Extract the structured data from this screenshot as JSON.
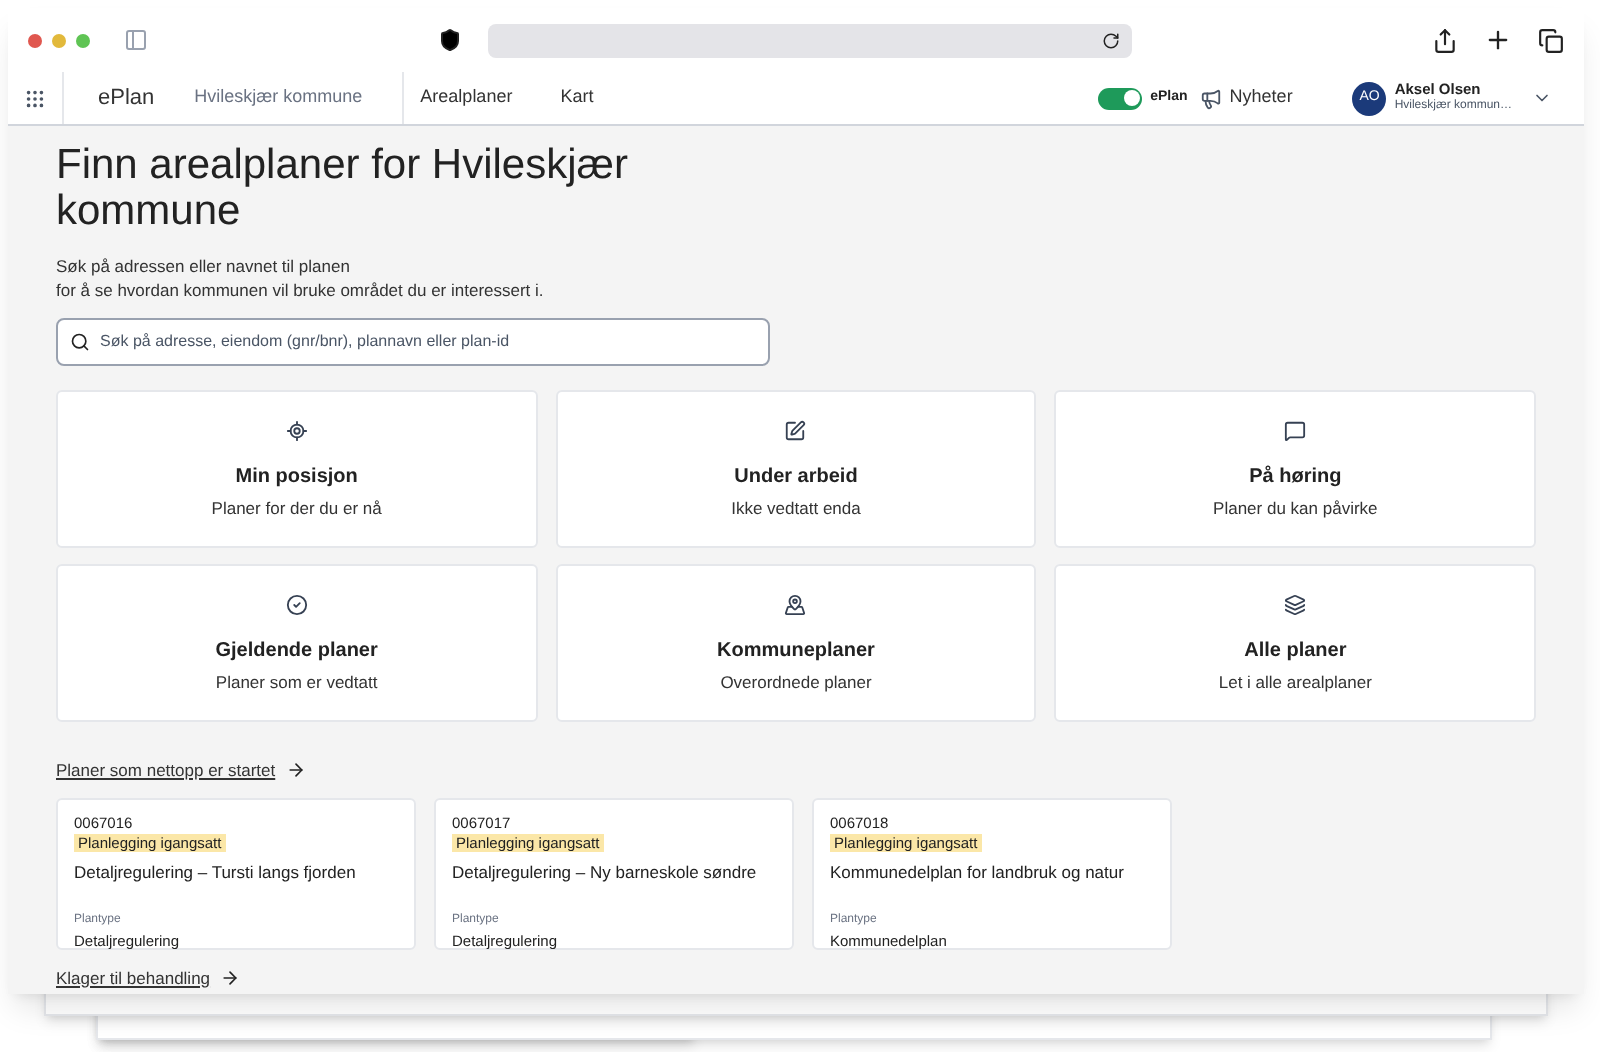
{
  "app_bar": {
    "brand": "ePlan",
    "municipality": "Hvileskjær kommune",
    "nav": [
      {
        "label": "Arealplaner",
        "selected": false
      },
      {
        "label": "Kart",
        "selected": false
      }
    ],
    "toggle": {
      "label": "ePlan",
      "on": true
    },
    "news": "Nyheter",
    "user": {
      "initials": "AO",
      "name": "Aksel Olsen",
      "org": "Hvileskjær kommun…"
    }
  },
  "heading": "Finn arealplaner for Hvileskjær kommune",
  "intro": [
    "Søk på adressen eller navnet til planen",
    "for å se hvordan kommunen vil bruke området du er interessert i."
  ],
  "search": {
    "placeholder": "Søk på adresse, eiendom (gnr/bnr), plannavn eller plan-id"
  },
  "categories": [
    {
      "kind": "position",
      "title": "Min posisjon",
      "subtitle": "Planer for der du er nå"
    },
    {
      "kind": "work",
      "title": "Under arbeid",
      "subtitle": "Ikke vedtatt enda"
    },
    {
      "kind": "hearing",
      "title": "På høring",
      "subtitle": "Planer du kan påvirke"
    },
    {
      "kind": "valid",
      "title": "Gjeldende planer",
      "subtitle": "Planer som er vedtatt"
    },
    {
      "kind": "municipal",
      "title": "Kommuneplaner",
      "subtitle": "Overordnede planer"
    },
    {
      "kind": "all",
      "title": "Alle planer",
      "subtitle": "Let i alle arealplaner"
    }
  ],
  "recent": {
    "title": "Planer som nettopp er startet",
    "plans": [
      {
        "id": "0067016",
        "status": "Planlegging igangsatt",
        "name": "Detaljregulering – Tursti langs fjorden",
        "type_label": "Plantype",
        "type": "Detaljregulering"
      },
      {
        "id": "0067017",
        "status": "Planlegging igangsatt",
        "name": "Detaljregulering – Ny barneskole søndre",
        "type_label": "Plantype",
        "type": "Detaljregulering"
      },
      {
        "id": "0067018",
        "status": "Planlegging igangsatt",
        "name": "Kommunedelplan for landbruk og natur",
        "type_label": "Plantype",
        "type": "Kommunedelplan"
      }
    ]
  },
  "complaints": {
    "title": "Klager til behandling"
  }
}
